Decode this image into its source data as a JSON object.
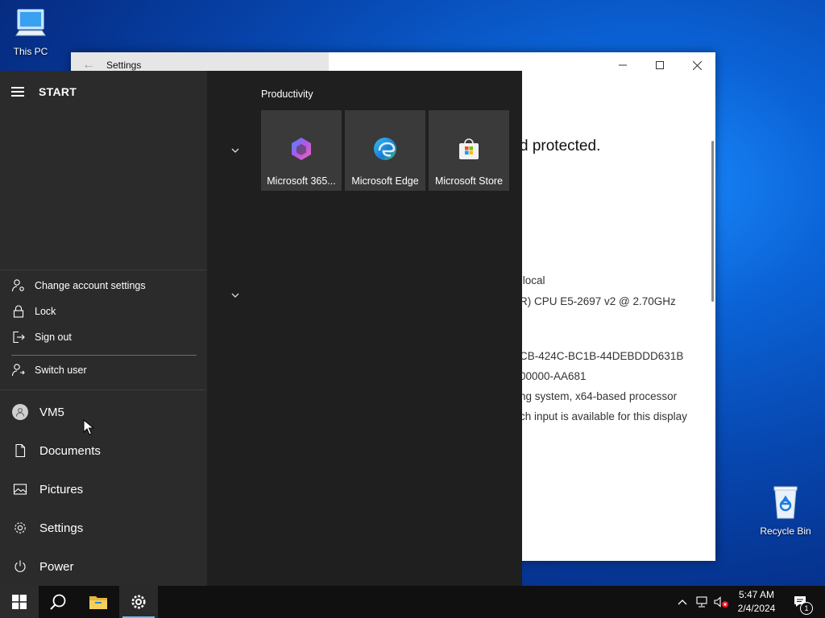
{
  "desktop": {
    "icons": [
      {
        "label": "This PC",
        "icon": "computer-icon"
      },
      {
        "label": "Recycle Bin",
        "icon": "recycle-bin-icon"
      }
    ]
  },
  "settings_window": {
    "title": "Settings",
    "heading_fragment": "d protected.",
    "rows": [
      ".local",
      "R) CPU E5-2697 v2 @ 2.70GHz",
      "CB-424C-BC1B-44DEBDDD631B",
      "00000-AA681",
      "ng system, x64-based processor",
      "ch input is available for this display"
    ]
  },
  "start_menu": {
    "title": "START",
    "account_menu": [
      {
        "label": "Change account settings",
        "icon": "person-gear-icon"
      },
      {
        "label": "Lock",
        "icon": "lock-icon"
      },
      {
        "label": "Sign out",
        "icon": "sign-out-icon"
      },
      {
        "label": "Switch user",
        "icon": "switch-user-icon"
      }
    ],
    "nav": [
      {
        "label": "VM5",
        "icon": "user-avatar-icon"
      },
      {
        "label": "Documents",
        "icon": "document-icon"
      },
      {
        "label": "Pictures",
        "icon": "pictures-icon"
      },
      {
        "label": "Settings",
        "icon": "gear-icon"
      },
      {
        "label": "Power",
        "icon": "power-icon"
      }
    ],
    "groups": [
      {
        "label": "Productivity",
        "tiles": [
          {
            "label": "Microsoft 365...",
            "icon": "microsoft-365-icon"
          },
          {
            "label": "Microsoft Edge",
            "icon": "edge-icon"
          },
          {
            "label": "Microsoft Store",
            "icon": "store-icon"
          }
        ]
      }
    ]
  },
  "taskbar": {
    "pinned": [
      "start-button",
      "search-icon",
      "file-explorer-icon",
      "settings-icon"
    ],
    "clock": {
      "time": "5:47 AM",
      "date": "2/4/2024"
    },
    "notification_count": "1"
  },
  "colors": {
    "accent": "#76b9ed",
    "start_bg": "#1f1f1f",
    "start_left_bg": "#2b2b2b",
    "tile_bg": "#3a3a3a",
    "taskbar_bg": "#101010"
  }
}
